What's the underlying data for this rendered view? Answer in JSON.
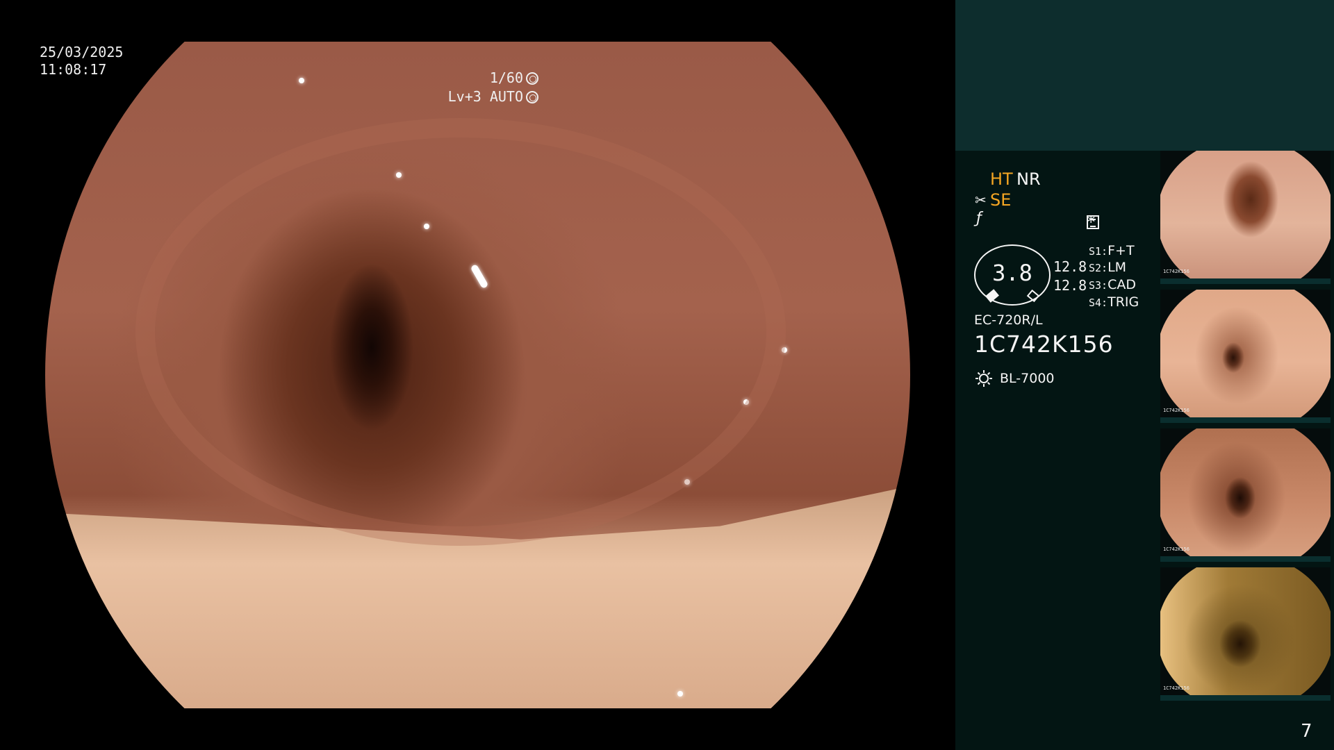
{
  "osd": {
    "date": "25/03/2025",
    "time": "11:08:17",
    "shutter": "1/60",
    "iris": "Lv+3 AUTO"
  },
  "modes": {
    "ht": "HT",
    "nr": "NR",
    "se": "SE",
    "star": "*"
  },
  "gauge": {
    "value": "3.8",
    "side_a": "12.8",
    "side_b": "12.8"
  },
  "switches": [
    {
      "key": "S1:",
      "value": "F+T"
    },
    {
      "key": "S2:",
      "value": "LM"
    },
    {
      "key": "S3:",
      "value": "CAD"
    },
    {
      "key": "S4:",
      "value": "TRIG"
    }
  ],
  "scope": {
    "model": "EC-720R/L",
    "serial": "1C742K156"
  },
  "light_source": "BL-7000",
  "thumbnails": [
    {
      "serial": "1C742K156"
    },
    {
      "serial": "1C742K156"
    },
    {
      "serial": "1C742K156"
    },
    {
      "serial": "1C742K156"
    }
  ],
  "page_number": "7",
  "colors": {
    "accent_orange": "#f5a623",
    "panel_bg": "#031513",
    "panel_top_bg": "#0d2d2d"
  },
  "icons": [
    "shutter-icon",
    "iris-icon",
    "scissors-icon",
    "filter-icon",
    "menu-icon",
    "light-source-icon"
  ]
}
